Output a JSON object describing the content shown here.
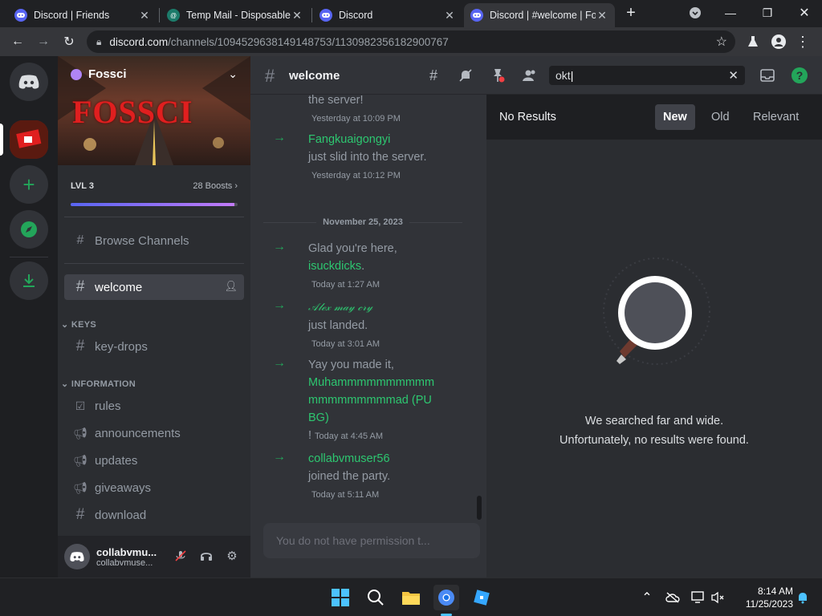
{
  "browser": {
    "tabs": [
      {
        "title": "Discord | Friends"
      },
      {
        "title": "Temp Mail - Disposable"
      },
      {
        "title": "Discord"
      },
      {
        "title": "Discord | #welcome | Fo"
      }
    ],
    "new_tab": "+",
    "url_host": "discord.com",
    "url_path": "/channels/1094529638149148753/1130982356182900767"
  },
  "server": {
    "name": "Fossci",
    "banner_text": "FOSSCI",
    "level": "LVL 3",
    "boosts": "28 Boosts",
    "boost_progress_pct": 98,
    "browse_label": "Browse Channels",
    "current_channel": "welcome",
    "categories": [
      {
        "label": "KEYS",
        "channels": [
          {
            "name": "key-drops"
          }
        ]
      },
      {
        "label": "INFORMATION",
        "channels": [
          {
            "name": "rules"
          },
          {
            "name": "announcements"
          },
          {
            "name": "updates"
          },
          {
            "name": "giveaways"
          },
          {
            "name": "download"
          }
        ]
      }
    ]
  },
  "user": {
    "name": "collabvmu...",
    "tag": "collabvmuse..."
  },
  "chat": {
    "header_channel": "welcome",
    "messages": [
      {
        "pre": "",
        "name": "",
        "post": "the server!",
        "time": "Yesterday at 10:09 PM"
      },
      {
        "pre": "",
        "name": "Fangkuaigongyi",
        "post": "just slid into the server.",
        "time": "Yesterday at 10:12 PM"
      },
      {
        "pre": "Glad you're here,",
        "name": "isuckdicks",
        "post": ".",
        "time": "Today at 1:27 AM"
      },
      {
        "pre": "",
        "name": "𝒜𝓁ℯ𝓍 𝓂𝒶𝓎 𝒸𝓇𝓎",
        "post": "just landed.",
        "time": "Today at 3:01 AM"
      },
      {
        "pre": "Yay you made it,",
        "name": "Muhammmmmmmmmmmmmmmmmmmad (PUBG)",
        "post": "!",
        "time": "Today at 4:45 AM"
      },
      {
        "pre": "",
        "name": "collabvmuser56",
        "post": "joined the party.",
        "time": "Today at 5:11 AM"
      }
    ],
    "date_divider": "November 25, 2023",
    "input_placeholder": "You do not have permission t..."
  },
  "search": {
    "query": "okt",
    "no_results": "No Results",
    "sort_new": "New",
    "sort_old": "Old",
    "sort_relevant": "Relevant",
    "empty_line1": "We searched far and wide.",
    "empty_line2": "Unfortunately, no results were found."
  },
  "taskbar": {
    "time": "8:14 AM",
    "date": "11/25/2023"
  },
  "colors": {
    "accent": "#5865f2",
    "green": "#23a55a",
    "bg": "#313338"
  }
}
